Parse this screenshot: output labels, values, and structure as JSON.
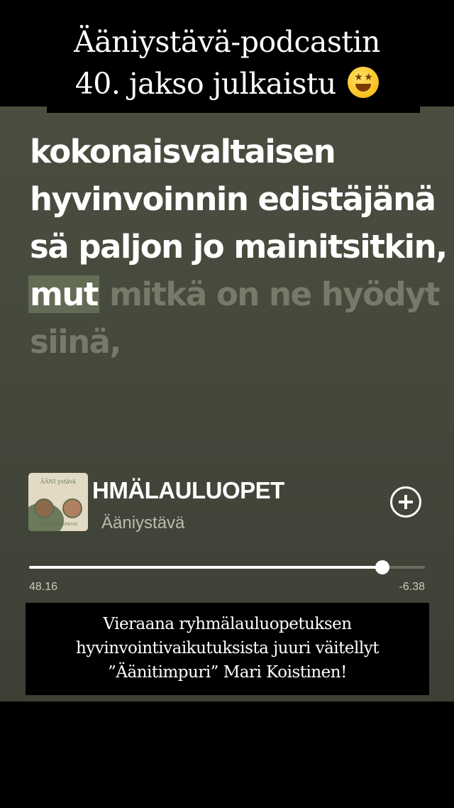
{
  "top_caption": {
    "line1": "Ääniystävä-podcastin",
    "line2": "40. jakso julkaistu",
    "emoji": "star-struck-emoji"
  },
  "lyrics": {
    "line1": "kokonaisvaltaisen",
    "line2": "hyvinvoinnin edistäjänä",
    "line3": "sä paljon jo mainitsitkin,",
    "line4_active": "mut",
    "line4_rest": " mitkä on ne hyödyt",
    "line5": "siinä,"
  },
  "player": {
    "track_title": "HMÄLAULUOPET",
    "artist": "Ääniystävä",
    "elapsed": "48.16",
    "remaining": "-6.38",
    "progress_fraction": 0.8925,
    "add_icon": "add-circle-icon",
    "cover_art": {
      "title": "ÄÄNI ystävä",
      "subtitle": "RYHMÄLAULUOPETUS"
    }
  },
  "bottom_caption": {
    "line1": "Vieraana ryhmälauluopetuksen",
    "line2": "hyvinvointivaikutuksista juuri väitellyt",
    "line3": "”Äänitimpuri” Mari Koistinen!"
  },
  "colors": {
    "background": "#474b3d",
    "lyric_dim": "#767a68",
    "highlight": "#656c55"
  }
}
